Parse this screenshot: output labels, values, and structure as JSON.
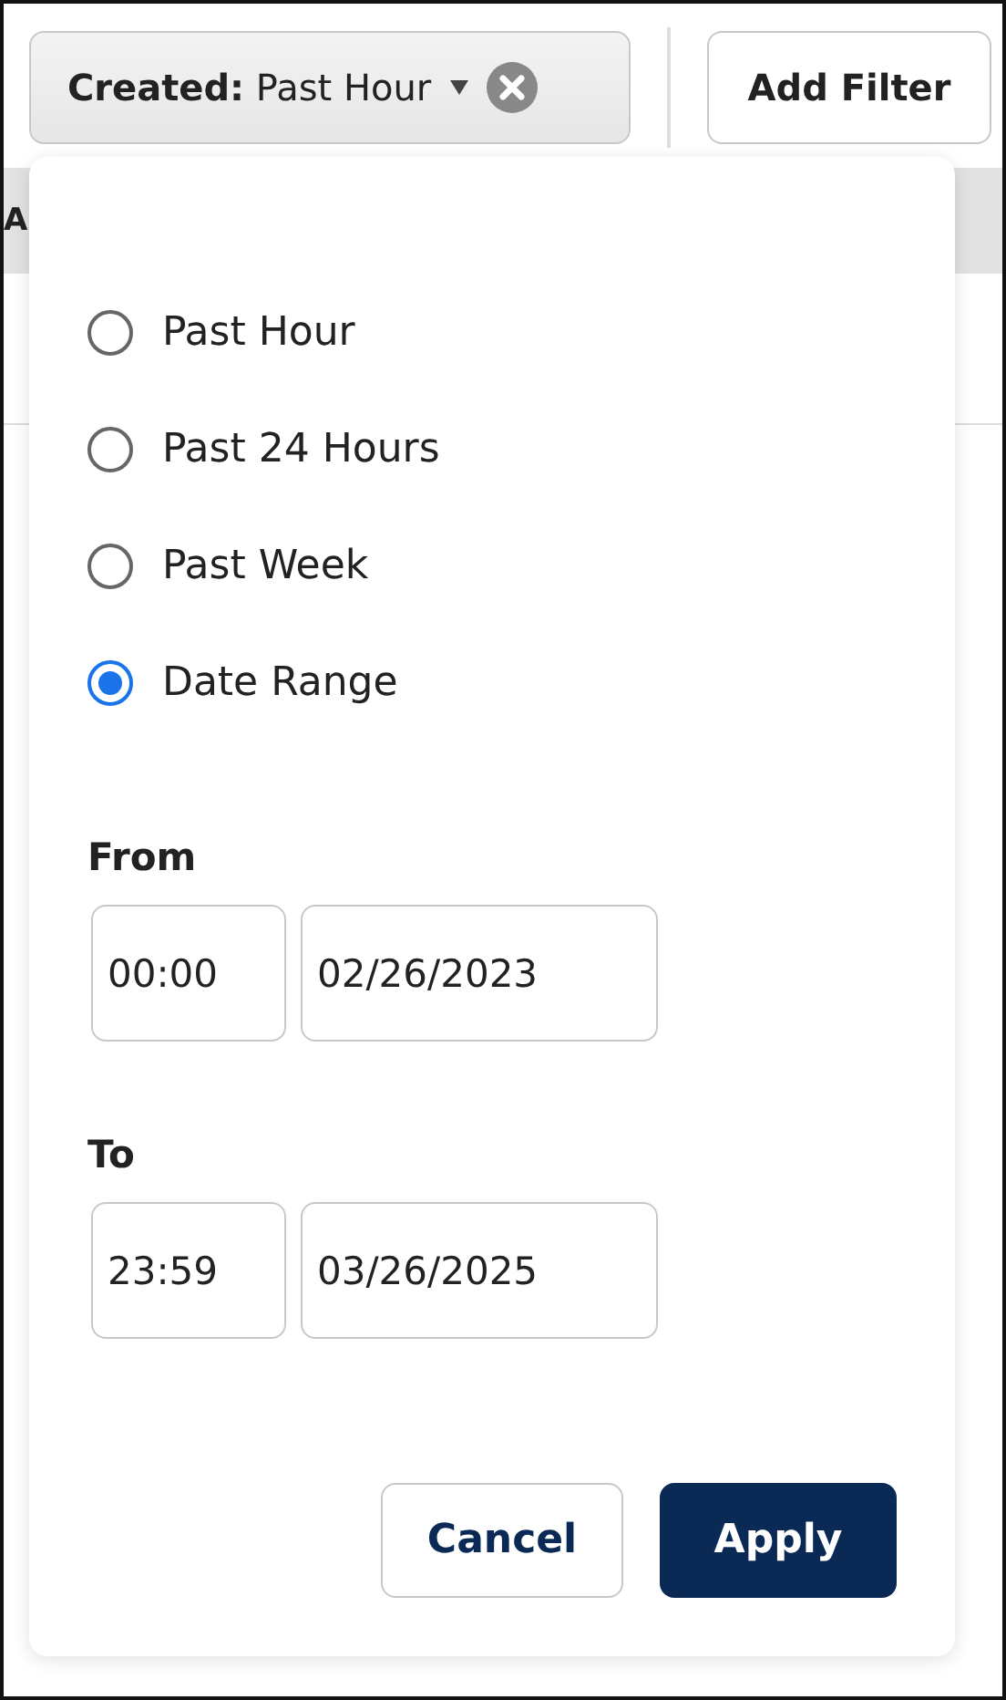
{
  "filter_chip": {
    "label": "Created:",
    "value": "Past Hour"
  },
  "add_filter_button": "Add Filter",
  "background_header": {
    "text": "A"
  },
  "popover": {
    "options": [
      {
        "label": "Past Hour",
        "selected": false
      },
      {
        "label": "Past 24 Hours",
        "selected": false
      },
      {
        "label": "Past Week",
        "selected": false
      },
      {
        "label": "Date Range",
        "selected": true
      }
    ],
    "ranges": [
      {
        "label": "From",
        "time": "00:00",
        "date": "02/26/2023"
      },
      {
        "label": "To",
        "time": "23:59",
        "date": "03/26/2025"
      }
    ],
    "buttons": [
      {
        "kind": "secondary",
        "label": "Cancel"
      },
      {
        "kind": "primary",
        "label": "Apply"
      }
    ]
  }
}
